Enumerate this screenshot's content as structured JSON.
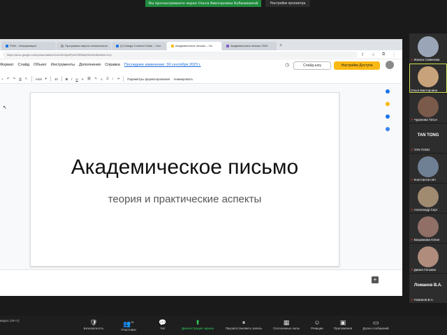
{
  "banner": {
    "sharing_text": "Вы просматриваете экран Ольги Викторовны Кубышкиной",
    "view_options": "Настройки просмотра"
  },
  "browser": {
    "tabs": [
      {
        "label": "PUM – Информация",
        "color": "#1a73e8"
      },
      {
        "label": "Программы научно-технического",
        "color": "#9e9e9e"
      },
      {
        "label": "(1) Kaluga Contract Chain – Госг",
        "color": "#1a73e8"
      },
      {
        "label": "Академическое письмо – Go",
        "color": "#f9b914"
      },
      {
        "label": "Академическое письмо 2023",
        "color": "#7e57c2"
      }
    ],
    "url": "https://docs.google.com/presentation/d/1zL8bXsjAlPpW/20B5dpMIlx4/edit#slide=id.p"
  },
  "slides_app": {
    "menu": [
      "Формат",
      "Слайд",
      "Объект",
      "Инструменты",
      "Дополнения",
      "Справка"
    ],
    "last_edit": "Последнее изменение: 30 сентября 2023 г.",
    "slideshow": "Слайд-шоу",
    "access": "Настройки Доступа",
    "toolbar": {
      "font": "Arial",
      "size": "10",
      "format_options": "Параметры форматирования",
      "animate": "Анимировать"
    },
    "slide": {
      "title": "Академическое письмо",
      "subtitle": "теория и практические аспекты"
    }
  },
  "participants": [
    {
      "name": "Жанна Семенова",
      "avatar": "#9aa6b8"
    },
    {
      "name": "Ольга Викторовна",
      "avatar": "#c8a27a"
    },
    {
      "name": "Чуранова Татья",
      "avatar": "#7a5a4a"
    },
    {
      "name": "TAN TONG",
      "big": "TAN TONG"
    },
    {
      "name": "Константин Ил",
      "avatar": "#6f7f94"
    },
    {
      "name": "Александр Серг",
      "avatar": "#a08a70"
    },
    {
      "name": "Вахрамова Юлия",
      "avatar": "#8f6f66"
    },
    {
      "name": "Диана Гатьман",
      "avatar": "#b08c7c"
    },
    {
      "name": "Ломанов В.А.",
      "big": "Ломанов В.А."
    }
  ],
  "controls": {
    "left_text": "видео (Alt+V)",
    "items": [
      {
        "label": "Безопасность",
        "icon": "🛡"
      },
      {
        "label": "Участники",
        "icon": "👥",
        "badge": "31"
      },
      {
        "label": "Чат",
        "icon": "💬"
      },
      {
        "label": "Демонстрация экрана",
        "icon": "⬆"
      },
      {
        "label": "Пауза/остановить запись",
        "icon": "⏸"
      },
      {
        "label": "Сессионные залы",
        "icon": "▦"
      },
      {
        "label": "Реакции",
        "icon": "☺"
      },
      {
        "label": "Приложения",
        "icon": "▣"
      },
      {
        "label": "Доски сообщений",
        "icon": "▭"
      }
    ]
  }
}
